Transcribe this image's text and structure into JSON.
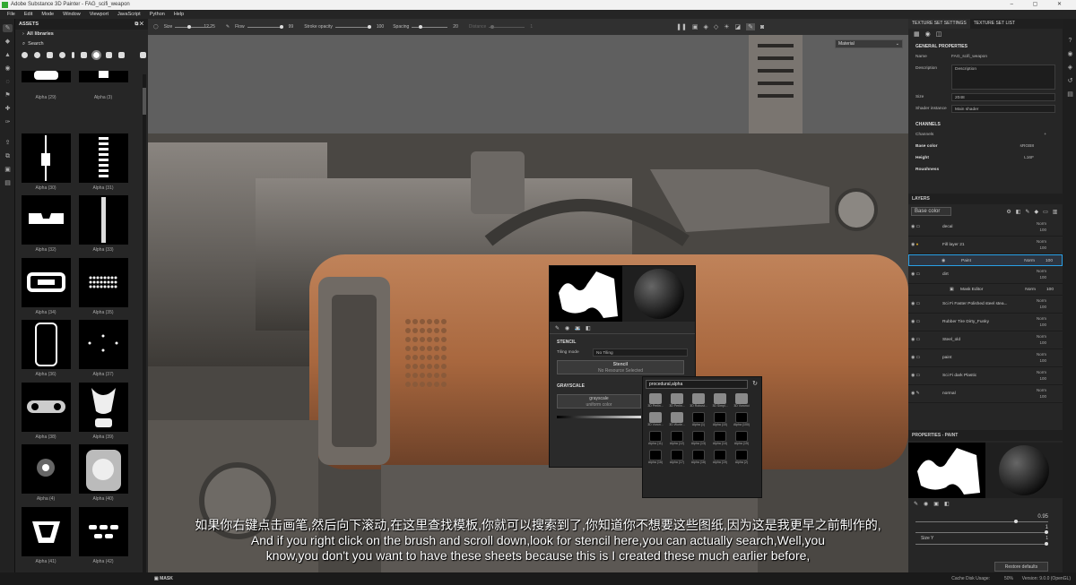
{
  "window": {
    "title": "Adobe Substance 3D Painter - FAG_scifi_weapon",
    "controls": "– ▢ ✕"
  },
  "menu": [
    "File",
    "Edit",
    "Mode",
    "Window",
    "Viewport",
    "JavaScript",
    "Python",
    "Help"
  ],
  "assets": {
    "title": "ASSETS",
    "all_libraries": "All libraries",
    "search_placeholder": "Search",
    "items": [
      "Alpha (29)",
      "Alpha (3)",
      "Alpha (30)",
      "Alpha (31)",
      "Alpha (32)",
      "Alpha (33)",
      "Alpha (34)",
      "Alpha (35)",
      "Alpha (36)",
      "Alpha (37)",
      "Alpha (38)",
      "Alpha (39)",
      "Alpha (4)",
      "Alpha (40)",
      "Alpha (41)",
      "Alpha (42)"
    ],
    "mask_label": "MASK"
  },
  "toolbar": {
    "size_label": "Size",
    "size_value": "12.25",
    "flow_label": "Flow",
    "flow_value": "99",
    "stroke_opacity_label": "Stroke opacity",
    "stroke_opacity_value": "100",
    "spacing_label": "Spacing",
    "spacing_value": "20",
    "distance_label": "Distance",
    "distance_value": "1"
  },
  "viewport": {
    "material_select": "Material"
  },
  "texture_set": {
    "tab1": "TEXTURE SET SETTINGS",
    "tab2": "TEXTURE SET LIST",
    "general": "GENERAL PROPERTIES",
    "name_label": "Name",
    "name_value": "FAG_scifi_weapon",
    "desc_label": "Description",
    "desc_value": "Description",
    "size_label": "Size",
    "size_value": "2048",
    "shader_label": "Shader instance",
    "shader_value": "Main shader",
    "channels": "CHANNELS",
    "channels_label": "Channels",
    "base_color": "Base color",
    "base_color_fmt": "sRGB8",
    "height": "Height",
    "height_fmt": "L16F",
    "roughness": "Roughness"
  },
  "layers": {
    "title": "LAYERS",
    "channel": "Base color",
    "rows": [
      {
        "name": "decal",
        "blend": "Norm",
        "opacity": "100"
      },
      {
        "name": "Fill layer 21",
        "blend": "Norm",
        "opacity": "100"
      },
      {
        "name": "Paint",
        "blend": "Norm",
        "opacity": "100"
      },
      {
        "name": "dirt",
        "blend": "Norm",
        "opacity": "100"
      },
      {
        "name": "Mask Editor",
        "blend": "Norm",
        "opacity": "100"
      },
      {
        "name": "Sci Fi Faster Polished steel stea...",
        "blend": "Norm",
        "opacity": "100"
      },
      {
        "name": "Rubber Tire Dirty_Funky",
        "blend": "Norm",
        "opacity": "100"
      },
      {
        "name": "Steel_old",
        "blend": "Norm",
        "opacity": "100"
      },
      {
        "name": "paint",
        "blend": "Norm",
        "opacity": "100"
      },
      {
        "name": "Sci Fi dark Plastic",
        "blend": "Norm",
        "opacity": "100"
      },
      {
        "name": "normal",
        "blend": "Norm",
        "opacity": "100"
      }
    ]
  },
  "properties": {
    "title": "PROPERTIES - PAINT",
    "value1": "0.95",
    "value2": "1",
    "size_y": "Size Y",
    "value3": "1",
    "restore": "Restore defaults"
  },
  "popup": {
    "stencil": "STENCIL",
    "tiling_label": "Tiling mode",
    "tiling_value": "No Tiling",
    "stencil_btn": "Stencil",
    "stencil_sub": "No Resource Selected",
    "grayscale": "GRAYSCALE",
    "gray_btn": "grayscale",
    "gray_sub": "uniform color"
  },
  "search": {
    "query": "procedural,alpha",
    "results": [
      "3D Perlin...",
      "3D Perlin...",
      "3D Robust...",
      "3D Simpl...",
      "3D Voronoi",
      "3D Voron...",
      "3D Worle...",
      "Alpha (1)",
      "Alpha (10)",
      "Alpha (100)",
      "Alpha (11)",
      "Alpha (12)",
      "Alpha (13)",
      "Alpha (14)",
      "Alpha (15)",
      "Alpha (16)",
      "Alpha (17)",
      "Alpha (18)",
      "Alpha (19)",
      "Alpha (2)"
    ]
  },
  "status": {
    "cache": "Cache Disk Usage:",
    "cache_value": "50%",
    "version": "Version: 9.0.0 (OpenGL)"
  },
  "subtitles": {
    "zh": "如果你右键点击画笔,然后向下滚动,在这里查找模板,你就可以搜索到了,你知道你不想要这些图纸,因为这是我更早之前制作的,",
    "en1": "And if you right click on the brush and scroll down,look for stencil here,you can actually search,Well,you",
    "en2": "know,you don't you want to have these sheets because this is I created these much earlier before,"
  },
  "colors": {
    "accent": "#2aa0e6",
    "viewport_bg": "#5f5f5f",
    "rust": "#a8673e"
  }
}
